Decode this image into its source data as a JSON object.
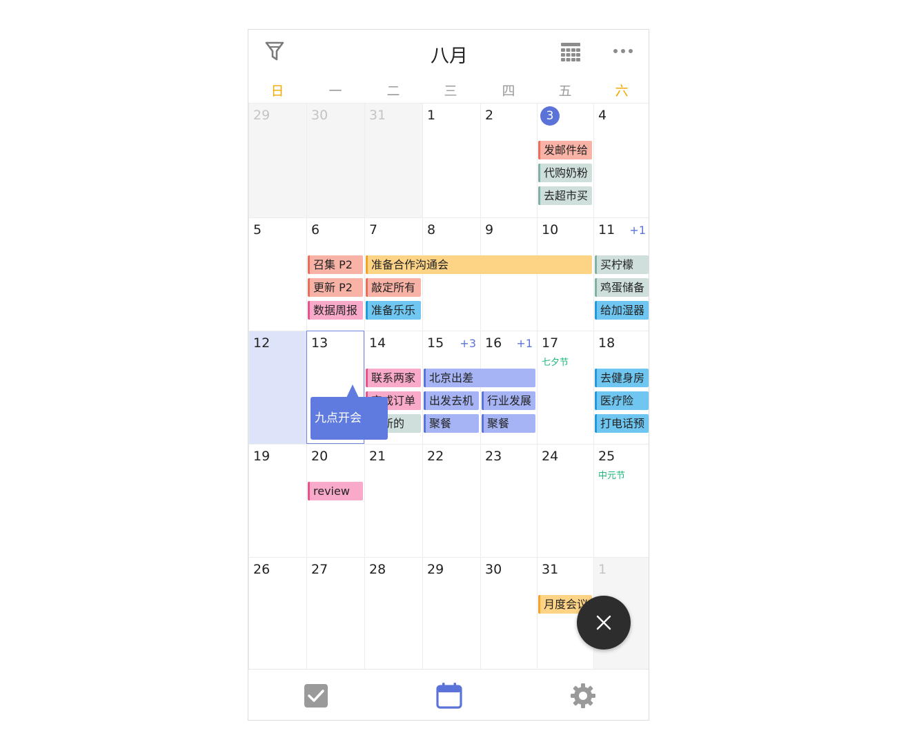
{
  "header": {
    "month_title": "八月",
    "icons": [
      "filter-icon",
      "month-grid-icon",
      "more-icon"
    ]
  },
  "weekdays": [
    "日",
    "一",
    "二",
    "三",
    "四",
    "五",
    "六"
  ],
  "weeks": [
    {
      "days": [
        {
          "num": "29",
          "other": true
        },
        {
          "num": "30",
          "other": true
        },
        {
          "num": "31",
          "other": true
        },
        {
          "num": "1"
        },
        {
          "num": "2"
        },
        {
          "num": "3",
          "today": true
        },
        {
          "num": "4"
        }
      ],
      "events": [
        {
          "text": "发邮件给",
          "col": 5,
          "span": 1,
          "row": 0,
          "color": "red"
        },
        {
          "text": "代购奶粉",
          "col": 5,
          "span": 1,
          "row": 1,
          "color": "green"
        },
        {
          "text": "去超市买",
          "col": 5,
          "span": 1,
          "row": 2,
          "color": "green"
        }
      ]
    },
    {
      "days": [
        {
          "num": "5"
        },
        {
          "num": "6"
        },
        {
          "num": "7"
        },
        {
          "num": "8"
        },
        {
          "num": "9"
        },
        {
          "num": "10"
        },
        {
          "num": "11",
          "more": "+1"
        }
      ],
      "events": [
        {
          "text": "召集 P2",
          "col": 1,
          "span": 1,
          "row": 0,
          "color": "red"
        },
        {
          "text": "准备合作沟通会",
          "col": 2,
          "span": 4,
          "row": 0,
          "color": "yellow"
        },
        {
          "text": "买柠檬",
          "col": 6,
          "span": 1,
          "row": 0,
          "color": "green"
        },
        {
          "text": "更新 P2",
          "col": 1,
          "span": 1,
          "row": 1,
          "color": "red"
        },
        {
          "text": "敲定所有",
          "col": 2,
          "span": 1,
          "row": 1,
          "color": "red"
        },
        {
          "text": "鸡蛋储备",
          "col": 6,
          "span": 1,
          "row": 1,
          "color": "green"
        },
        {
          "text": "数据周报",
          "col": 1,
          "span": 1,
          "row": 2,
          "color": "pink"
        },
        {
          "text": "准备乐乐",
          "col": 2,
          "span": 1,
          "row": 2,
          "color": "blue"
        },
        {
          "text": "给加湿器",
          "col": 6,
          "span": 1,
          "row": 2,
          "color": "blue"
        }
      ]
    },
    {
      "days": [
        {
          "num": "12",
          "highlight": true
        },
        {
          "num": "13",
          "selected": true
        },
        {
          "num": "14"
        },
        {
          "num": "15",
          "more": "+3"
        },
        {
          "num": "16",
          "more": "+1"
        },
        {
          "num": "17",
          "holiday": "七夕节"
        },
        {
          "num": "18"
        }
      ],
      "events": [
        {
          "text": "联系两家",
          "col": 2,
          "span": 1,
          "row": 0,
          "color": "pink"
        },
        {
          "text": "北京出差",
          "col": 3,
          "span": 2,
          "row": 0,
          "color": "purple"
        },
        {
          "text": "去健身房",
          "col": 6,
          "span": 1,
          "row": 0,
          "color": "blue"
        },
        {
          "text": "完成订单",
          "col": 2,
          "span": 1,
          "row": 1,
          "color": "pink"
        },
        {
          "text": "出发去机",
          "col": 3,
          "span": 1,
          "row": 1,
          "color": "purple"
        },
        {
          "text": "行业发展",
          "col": 4,
          "span": 1,
          "row": 1,
          "color": "purple"
        },
        {
          "text": "医疗险",
          "col": 6,
          "span": 1,
          "row": 1,
          "color": "blue"
        },
        {
          "text": "最新的",
          "col": 2,
          "span": 1,
          "row": 2,
          "color": "green"
        },
        {
          "text": "聚餐",
          "col": 3,
          "span": 1,
          "row": 2,
          "color": "purple"
        },
        {
          "text": "聚餐",
          "col": 4,
          "span": 1,
          "row": 2,
          "color": "purple"
        },
        {
          "text": "打电话预",
          "col": 6,
          "span": 1,
          "row": 2,
          "color": "blue"
        }
      ]
    },
    {
      "days": [
        {
          "num": "19"
        },
        {
          "num": "20"
        },
        {
          "num": "21"
        },
        {
          "num": "22"
        },
        {
          "num": "23"
        },
        {
          "num": "24"
        },
        {
          "num": "25",
          "holiday": "中元节"
        }
      ],
      "events": [
        {
          "text": "review",
          "col": 1,
          "span": 1,
          "row": 0,
          "color": "pink"
        }
      ]
    },
    {
      "days": [
        {
          "num": "26"
        },
        {
          "num": "27"
        },
        {
          "num": "28"
        },
        {
          "num": "29"
        },
        {
          "num": "30"
        },
        {
          "num": "31"
        },
        {
          "num": "1",
          "other": true
        }
      ],
      "events": [
        {
          "text": "月度会议",
          "col": 5,
          "span": 1,
          "row": 0,
          "color": "yellow"
        }
      ]
    }
  ],
  "tooltip": {
    "text": "九点开会"
  },
  "fab": {
    "icon": "close-icon"
  },
  "bottom_tabs": [
    {
      "name": "tab-tasks",
      "icon": "checkbox-icon",
      "active": false
    },
    {
      "name": "tab-calendar",
      "icon": "calendar-icon",
      "active": true
    },
    {
      "name": "tab-settings",
      "icon": "gear-icon",
      "active": false
    }
  ],
  "colors": {
    "accent": "#5b73d8",
    "weekend": "#f2a900",
    "holiday": "#1bb87a",
    "fab": "#2d2d2d"
  }
}
